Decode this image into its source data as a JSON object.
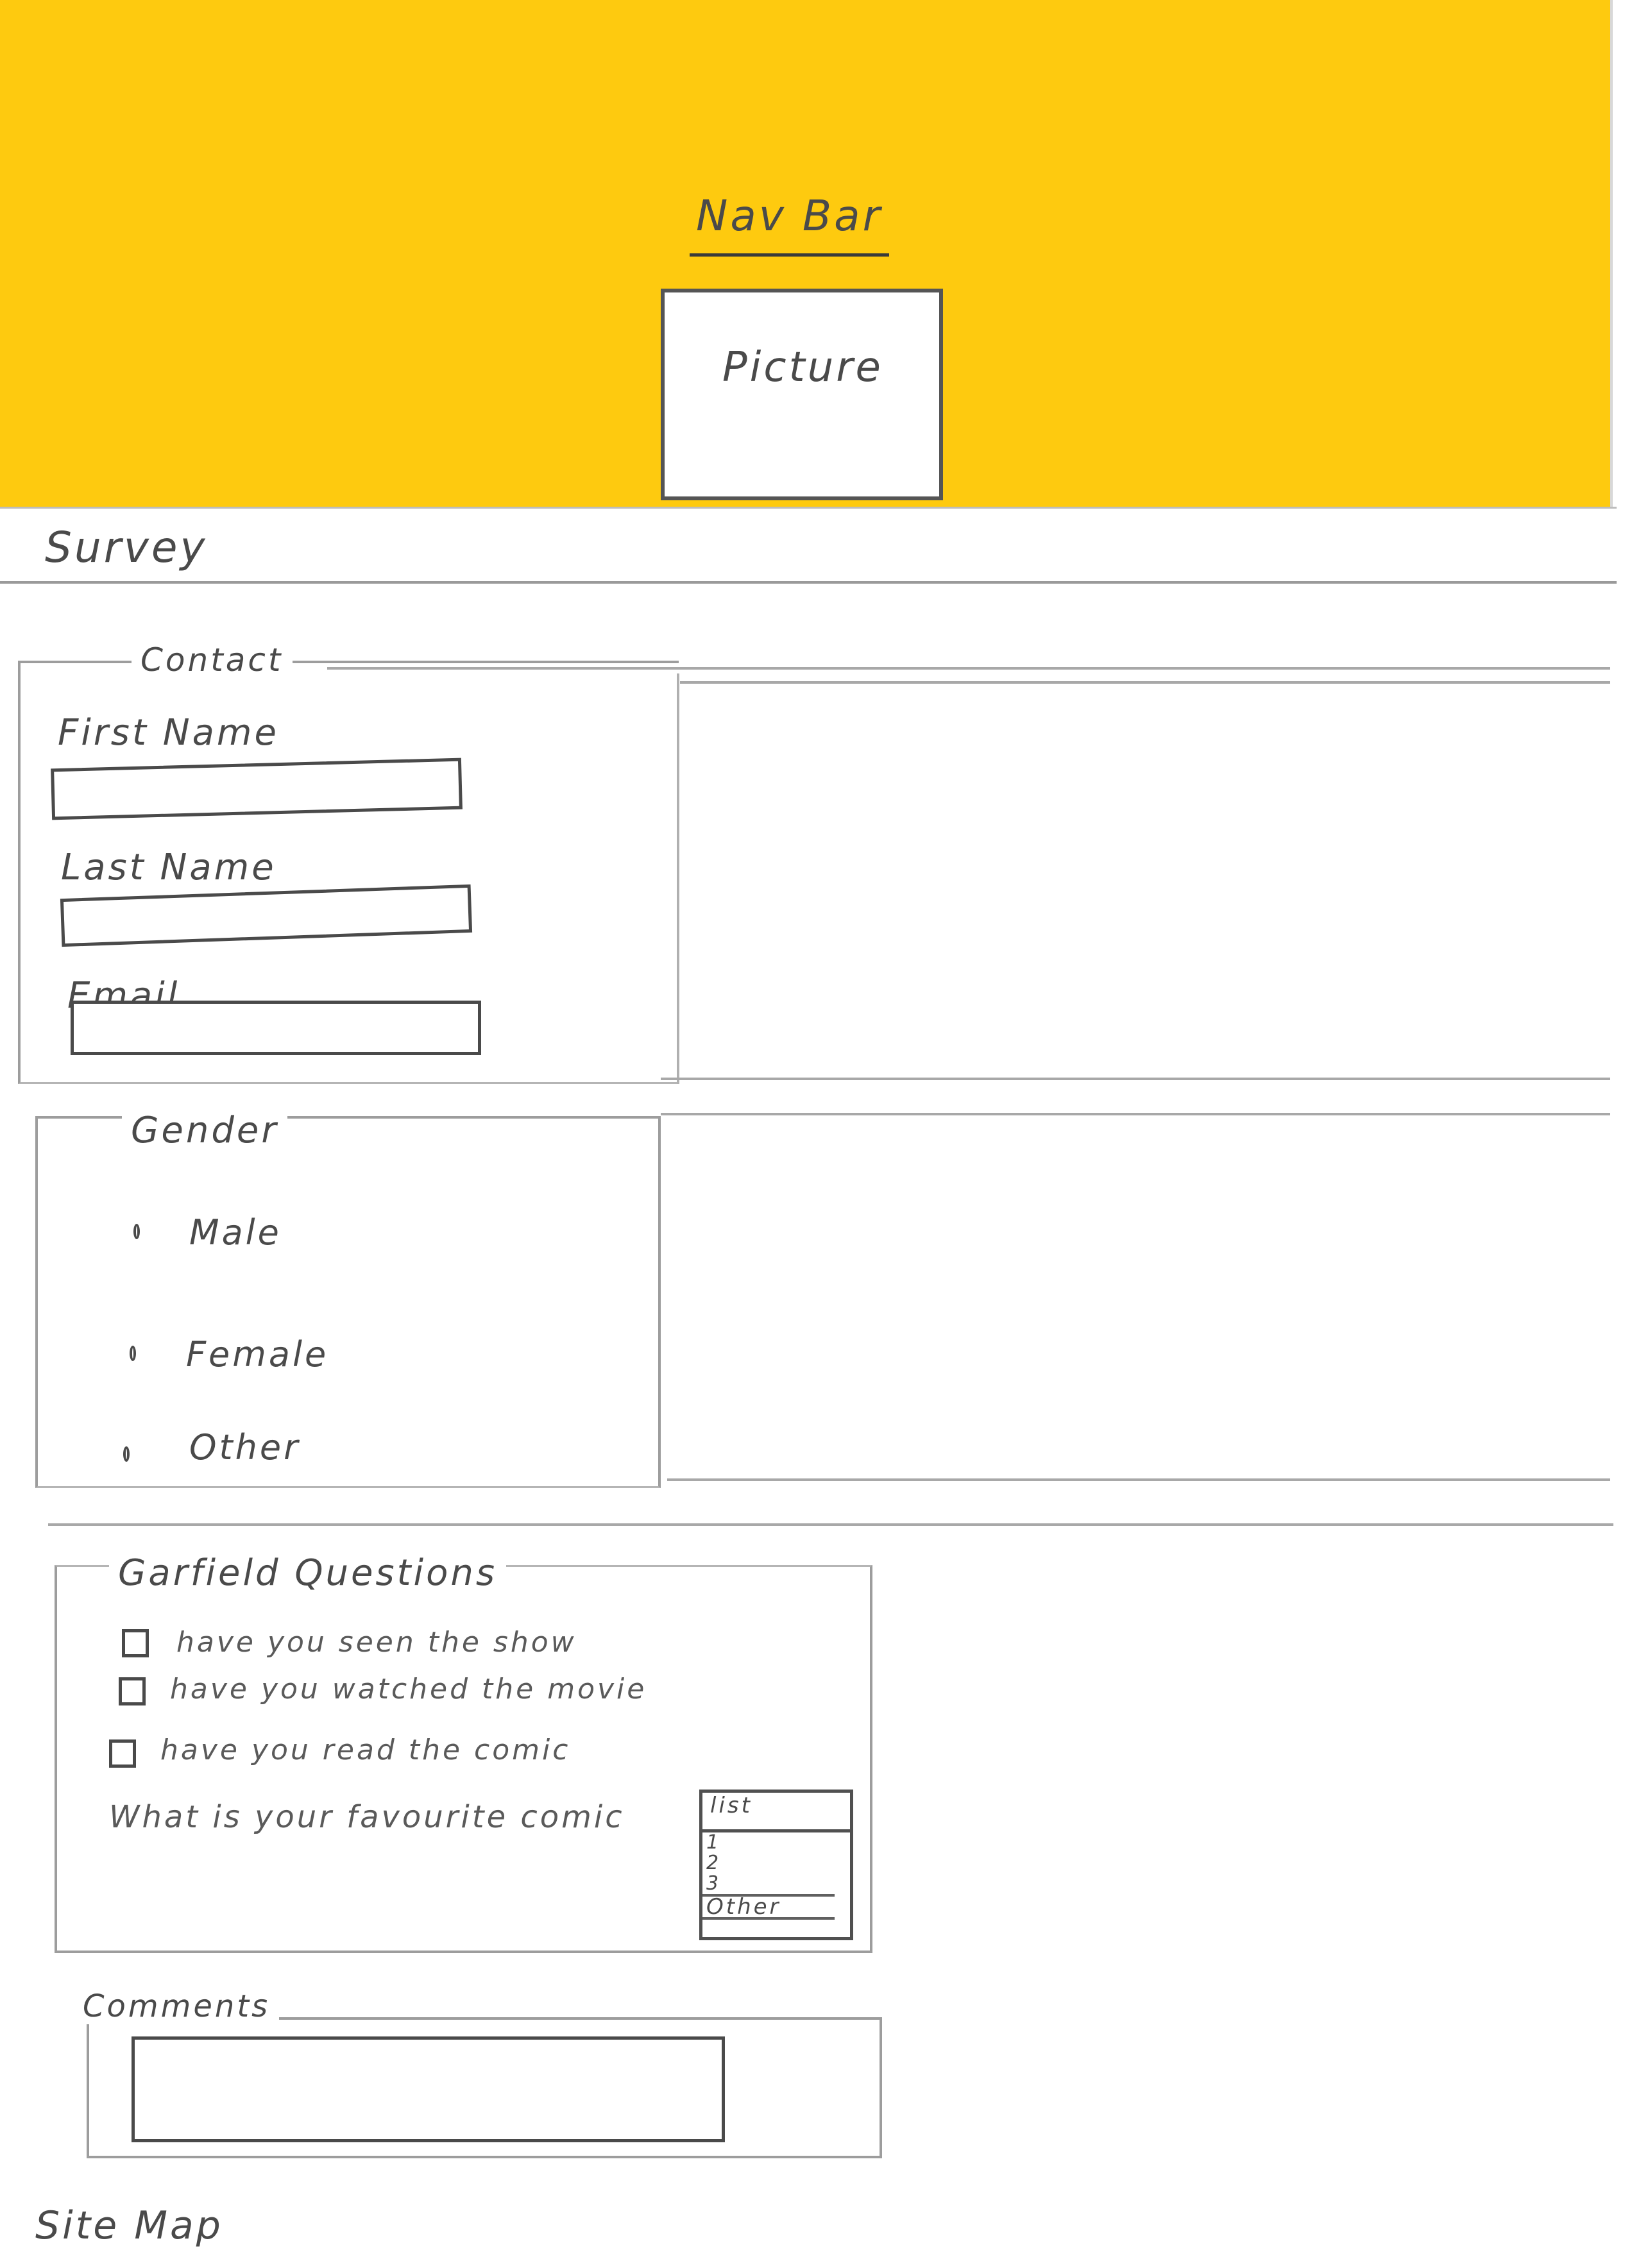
{
  "header": {
    "nav_label": "Nav Bar",
    "picture_label": "Picture",
    "background_color": "#FECA0F"
  },
  "survey": {
    "title": "Survey"
  },
  "contact": {
    "legend": "Contact",
    "first_name_label": "First Name",
    "last_name_label": "Last Name",
    "email_label": "Email"
  },
  "gender": {
    "legend": "Gender",
    "options": [
      "Male",
      "Female",
      "Other"
    ]
  },
  "garfield": {
    "legend": "Garfield Questions",
    "questions": [
      "have you seen the show",
      "have you watched the movie",
      "have you read the comic"
    ],
    "favourite_label": "What is your favourite comic",
    "list_options": [
      "list",
      "1",
      "2",
      "3",
      "Other"
    ]
  },
  "comments": {
    "legend": "Comments"
  },
  "footer": {
    "sitemap": "Site Map"
  }
}
